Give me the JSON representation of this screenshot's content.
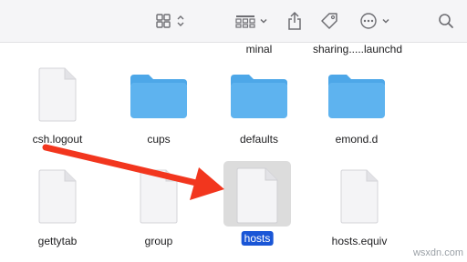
{
  "toolbar": {
    "icons": [
      "grid-view-icon",
      "sort-chevron-icon",
      "group-by-icon",
      "chevron-down-icon",
      "share-icon",
      "tag-icon",
      "more-icon",
      "search-icon"
    ]
  },
  "partial_row": [
    "minal",
    "sharing.....launchd"
  ],
  "files": [
    {
      "name": "csh.logout",
      "kind": "document"
    },
    {
      "name": "cups",
      "kind": "folder"
    },
    {
      "name": "defaults",
      "kind": "folder"
    },
    {
      "name": "emond.d",
      "kind": "folder"
    },
    {
      "name": "gettytab",
      "kind": "document"
    },
    {
      "name": "group",
      "kind": "document"
    },
    {
      "name": "hosts",
      "kind": "document",
      "selected": true
    },
    {
      "name": "hosts.equiv",
      "kind": "document"
    }
  ],
  "annotation": {
    "type": "arrow",
    "color": "#f2361e"
  },
  "watermark": "wsxdn.com",
  "colors": {
    "folder": "#5eb3ef",
    "selection": "#1a56d6",
    "arrow": "#f2361e"
  }
}
